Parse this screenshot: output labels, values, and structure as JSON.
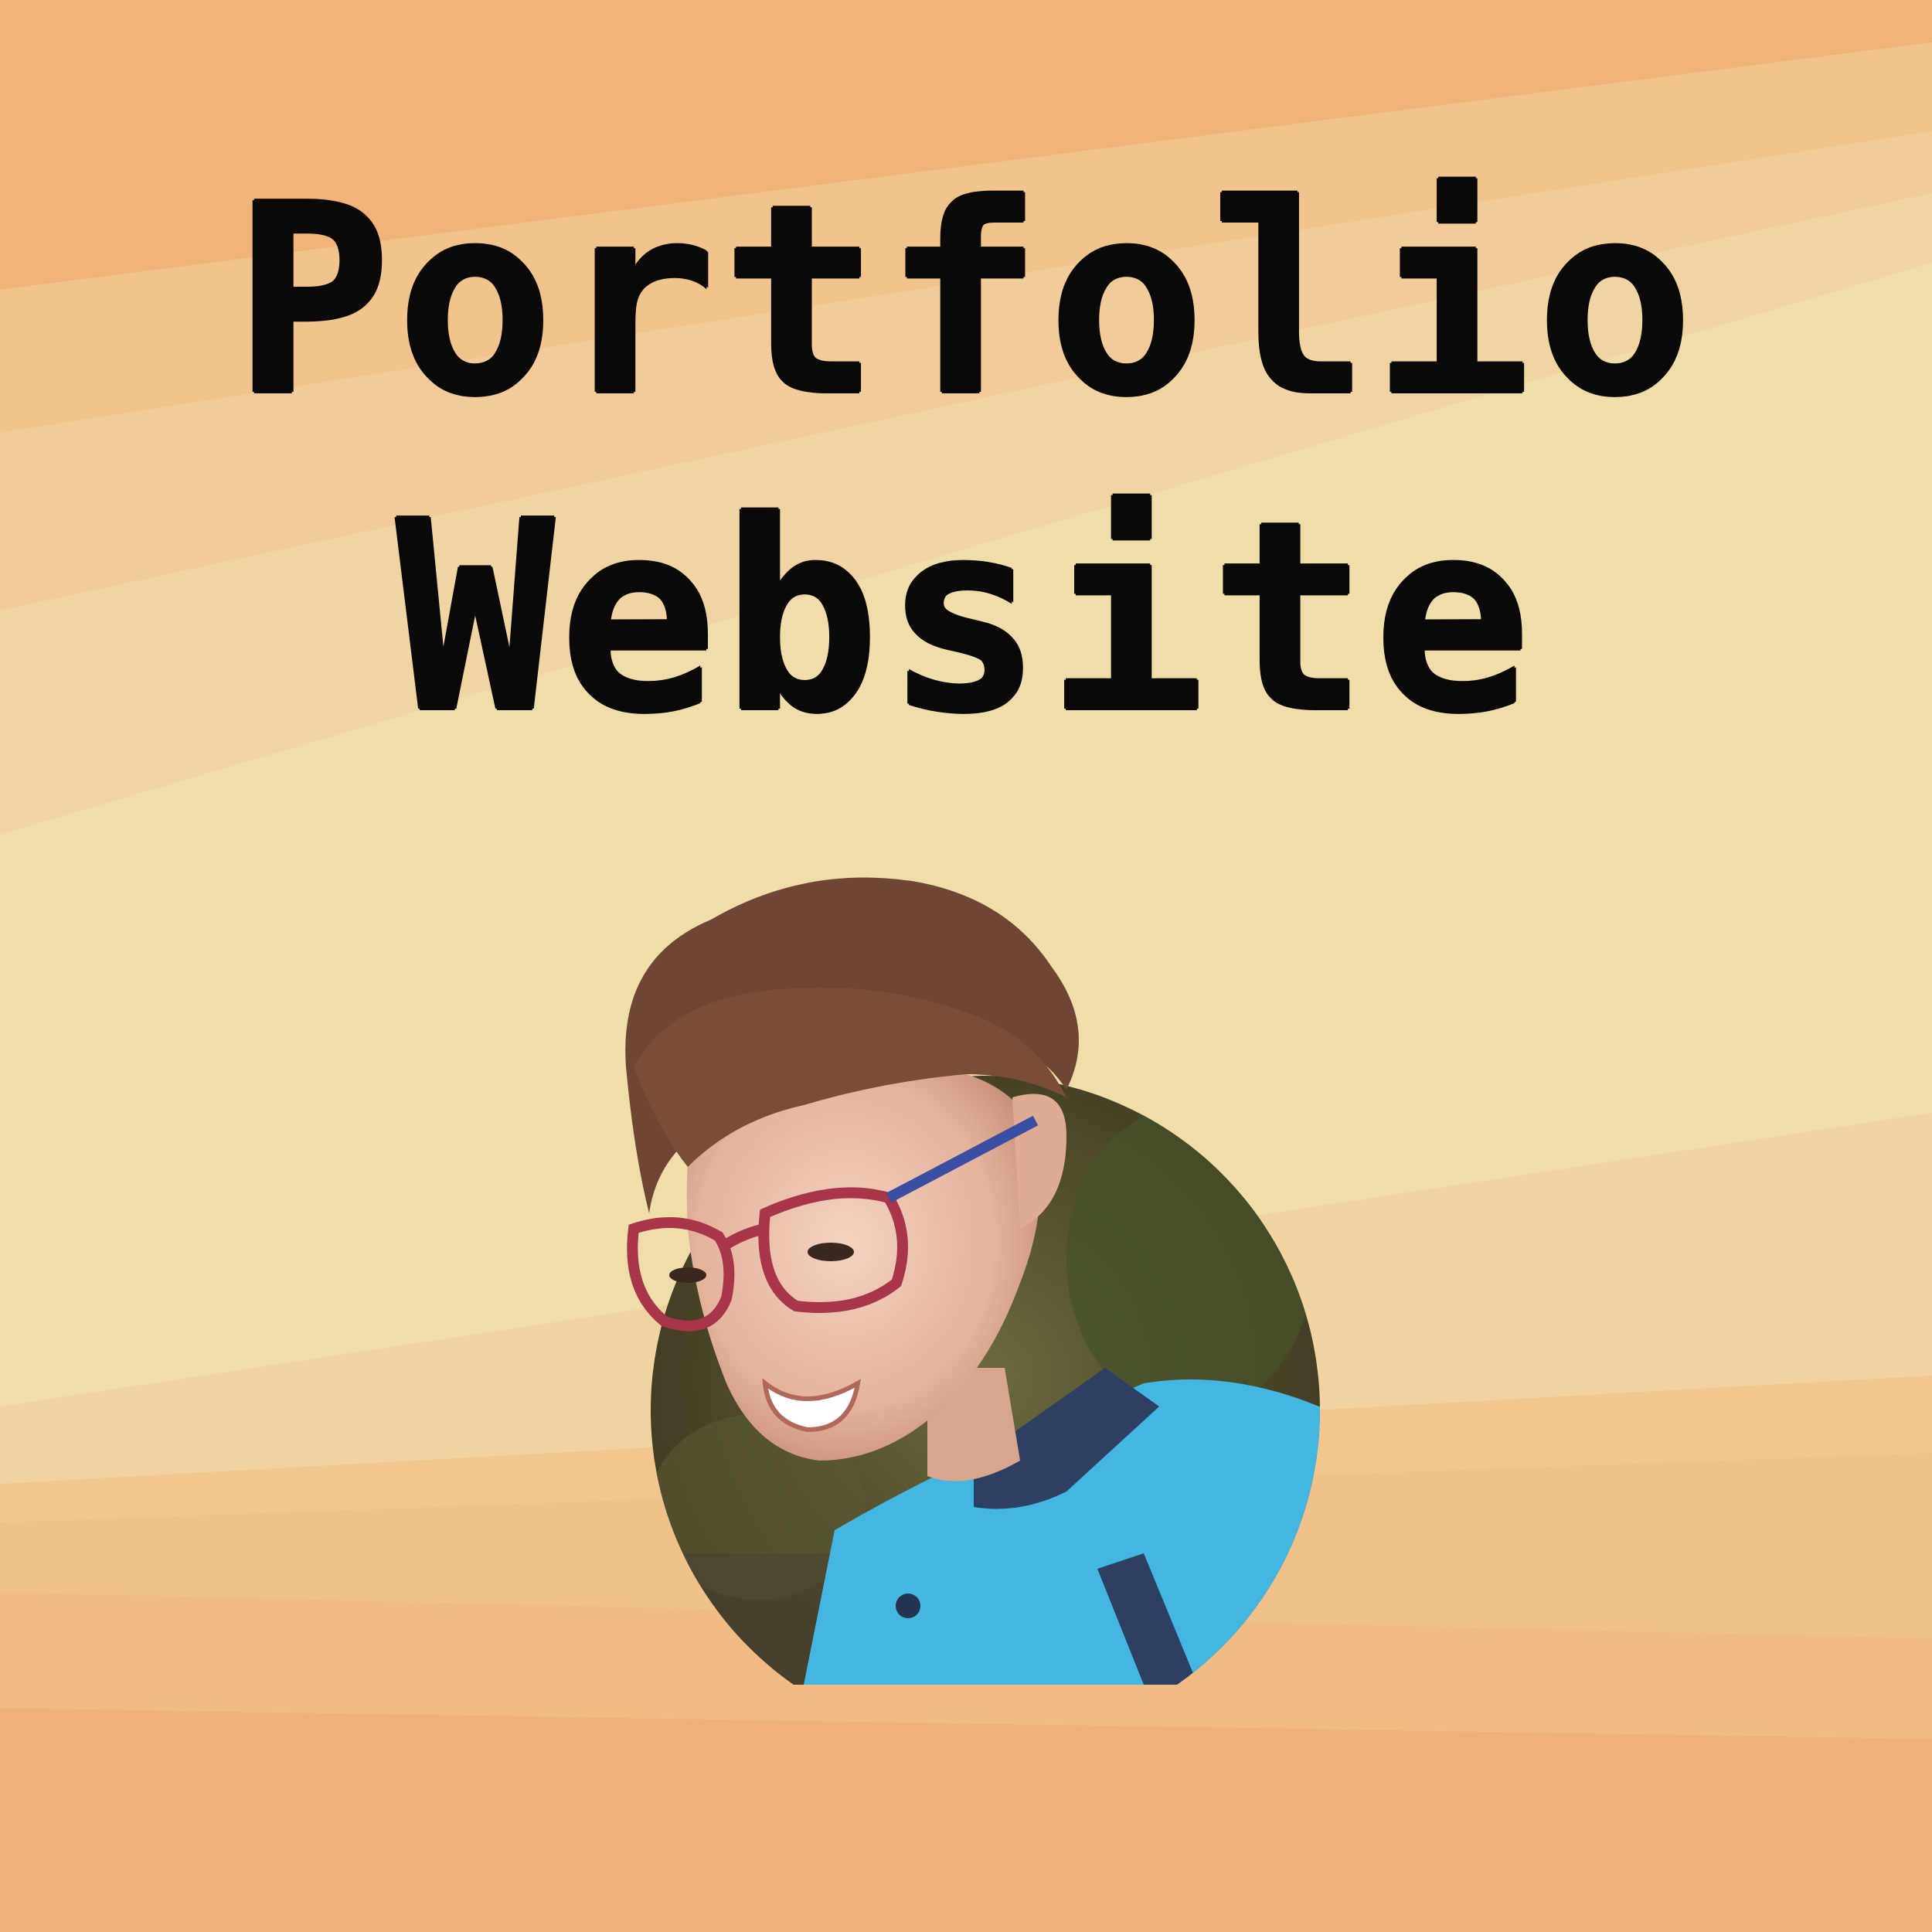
{
  "title": {
    "line1": "Portfolio",
    "line2": "Website"
  },
  "colors": {
    "background_light": "#efddaa",
    "background_mid": "#f0c48b",
    "background_dark": "#f1b27a",
    "text": "#0a0908",
    "jacket": "#44b6e2",
    "hair": "#6f4634",
    "glasses": "#a8354a"
  },
  "portrait": {
    "description_icon": "person-photo-icon"
  }
}
